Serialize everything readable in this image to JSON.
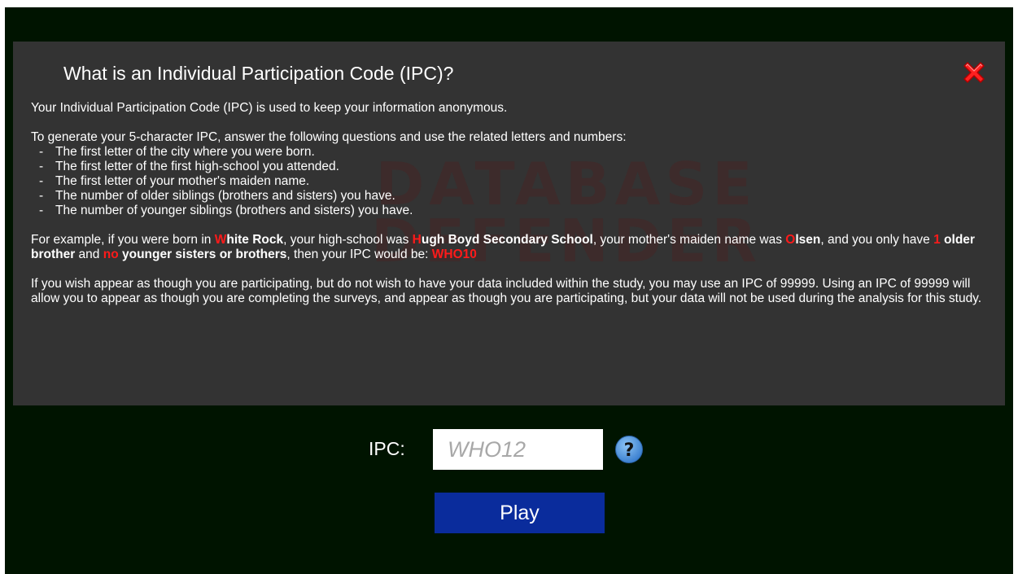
{
  "dialog": {
    "title": "What is an Individual Participation Code (IPC)?",
    "watermark_line1": "DATABASE",
    "watermark_line2": "DEFENDER",
    "intro": "Your Individual Participation Code (IPC) is used to keep your information anonymous.",
    "instructions": "To generate your 5-character IPC, answer the following questions and use the related letters and numbers:",
    "list": [
      {
        "dash": "-",
        "text": "The first letter of the city where you were born."
      },
      {
        "dash": "-",
        "text": "The first letter of the first high-school you attended."
      },
      {
        "dash": "-",
        "text": "The first letter of your mother's maiden name."
      },
      {
        "dash": "-",
        "text": "The number of older siblings (brothers and sisters) you have."
      },
      {
        "dash": "-",
        "text": "The number of younger siblings (brothers and sisters) you have."
      }
    ],
    "example": {
      "p1": "For example, if you were born in ",
      "w_hl": "W",
      "w_rest": "hite Rock",
      "p2": ", your high-school was ",
      "h_hl": "H",
      "h_rest": "ugh Boyd Secondary School",
      "p3": ", your mother's maiden name was ",
      "o_hl": "O",
      "o_rest": "lsen",
      "p4": ", and you only have ",
      "one_hl": "1",
      "one_rest": " older brother",
      "p5": " and ",
      "no_hl": "no",
      "no_rest": " younger sisters or brothers",
      "p6": ", then your IPC would be: ",
      "code": "WHO10"
    },
    "optout": "If you wish appear as though you are participating, but do not wish to have your data included within the study, you may use an IPC of 99999. Using an IPC of 99999 will allow you to appear as though you are completing the surveys, and appear as though you are participating, but your data will not be used during the analysis for this study."
  },
  "form": {
    "ipc_label": "IPC:",
    "ipc_value": "",
    "ipc_placeholder": "WHO12",
    "help_glyph": "?",
    "play_label": "Play"
  },
  "icons": {
    "close": "close-x-icon",
    "help": "question-mark-icon"
  },
  "colors": {
    "background": "#001400",
    "panel": "#333333",
    "highlight": "#ff1a1a",
    "play_button": "#0a2c9c",
    "help_icon": "#4a90d9"
  }
}
